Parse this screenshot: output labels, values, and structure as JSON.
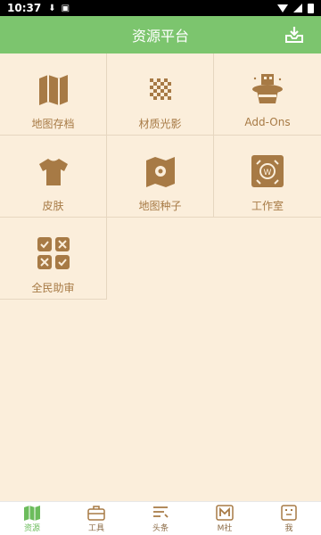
{
  "status_bar": {
    "time": "10:37"
  },
  "app_bar": {
    "title": "资源平台",
    "download_icon": "download-tray-icon"
  },
  "grid": {
    "items": [
      {
        "label": "地图存档",
        "icon": "map-icon"
      },
      {
        "label": "材质光影",
        "icon": "checker-texture-icon"
      },
      {
        "label": "Add-Ons",
        "icon": "magic-hat-icon"
      },
      {
        "label": "皮肤",
        "icon": "shirt-icon"
      },
      {
        "label": "地图种子",
        "icon": "map-seed-icon"
      },
      {
        "label": "工作室",
        "icon": "studio-icon"
      },
      {
        "label": "全民助审",
        "icon": "review-icon"
      }
    ]
  },
  "bottom_nav": {
    "items": [
      {
        "label": "资源",
        "active": true
      },
      {
        "label": "工具",
        "active": false
      },
      {
        "label": "头条",
        "active": false
      },
      {
        "label": "M社",
        "active": false
      },
      {
        "label": "我",
        "active": false
      }
    ]
  },
  "colors": {
    "accent": "#7cc56e",
    "icon_brown": "#a77a45",
    "background": "#fbeedb"
  }
}
